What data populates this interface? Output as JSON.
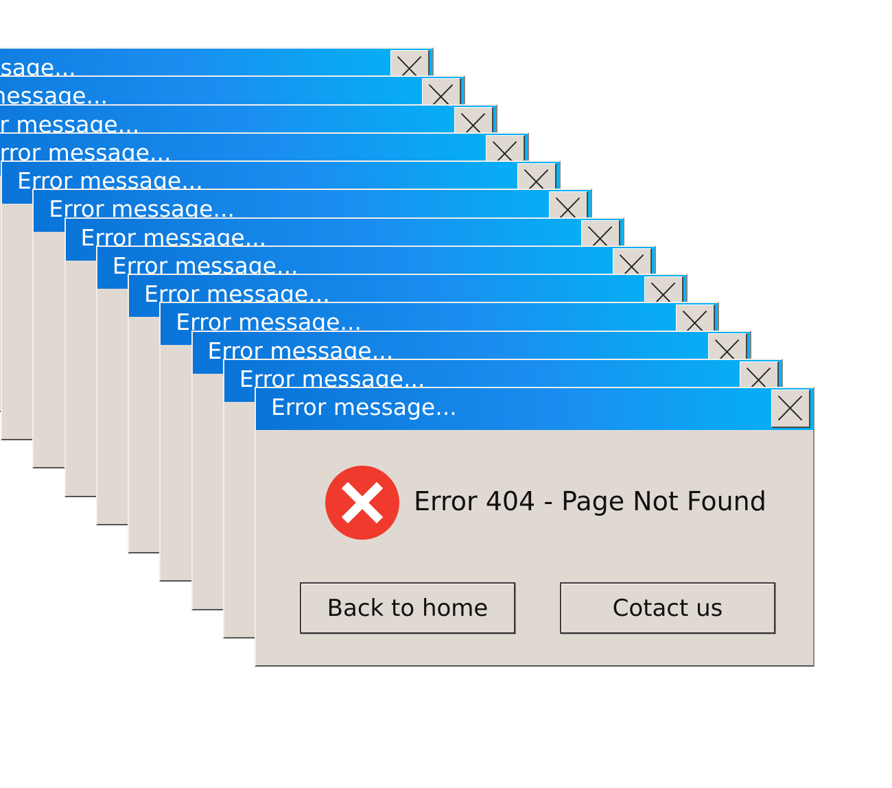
{
  "dialog_stack": {
    "count": 13,
    "window_title": "Error message...",
    "close_icon": "close-icon",
    "message": {
      "icon": "error-x-icon",
      "text": "Error 404 - Page Not Found"
    },
    "buttons": {
      "back_home": "Back to home",
      "contact": "Cotact us"
    }
  },
  "colors": {
    "titlebar_start": "#0a74d8",
    "titlebar_end": "#02b4f6",
    "dialog_body": "#e0d9d2",
    "error_icon": "#ef3a2d"
  }
}
